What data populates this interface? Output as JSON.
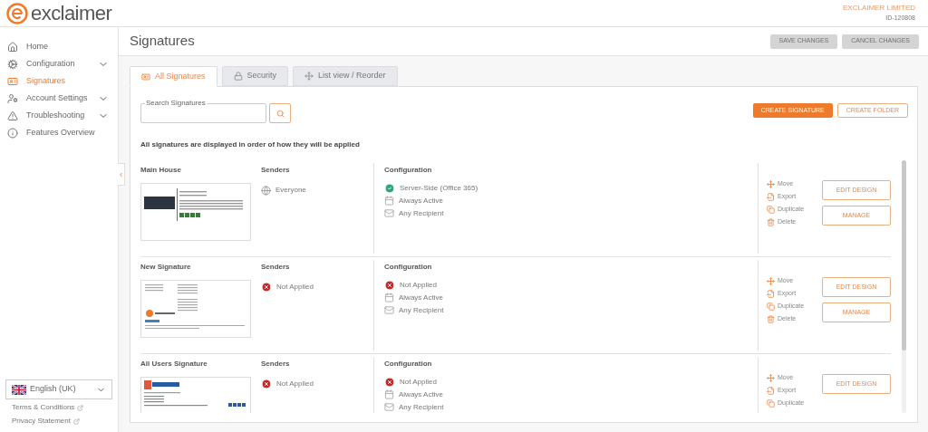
{
  "header": {
    "logo_text": "exclaimer",
    "account_name": "EXCLAIMER LIMITED",
    "account_id": "ID-120808"
  },
  "sidebar": {
    "items": [
      {
        "label": "Home",
        "selected": false,
        "expandable": false
      },
      {
        "label": "Configuration",
        "selected": false,
        "expandable": true
      },
      {
        "label": "Signatures",
        "selected": true,
        "expandable": false
      },
      {
        "label": "Account Settings",
        "selected": false,
        "expandable": true
      },
      {
        "label": "Troubleshooting",
        "selected": false,
        "expandable": true
      },
      {
        "label": "Features Overview",
        "selected": false,
        "expandable": false
      }
    ],
    "language": "English (UK)",
    "links": [
      "Terms & Conditions",
      "Privacy Statement"
    ]
  },
  "page": {
    "title": "Signatures",
    "buttons": [
      {
        "label": "SAVE CHANGES",
        "disabled": true
      },
      {
        "label": "CANCEL CHANGES",
        "disabled": true
      }
    ]
  },
  "tabs": [
    {
      "label": "All Signatures",
      "selected": true
    },
    {
      "label": "Security",
      "selected": false
    },
    {
      "label": "List view / Reorder",
      "selected": false
    }
  ],
  "search": {
    "label": "Search Signatures"
  },
  "actions": [
    {
      "label": "CREATE SIGNATURE",
      "kind": "primary"
    },
    {
      "label": "CREATE FOLDER",
      "kind": "outline"
    }
  ],
  "notice": "All signatures are displayed in order of how they will be applied",
  "signatures": [
    {
      "name": "Main House",
      "senders_heading": "Senders",
      "senders": {
        "text": "Everyone",
        "applied": true
      },
      "configuration_heading": "Configuration",
      "configuration": [
        {
          "text": "Server-Side (Office 365)",
          "kind": "status",
          "ok": true
        },
        {
          "text": "Always Active",
          "kind": "schedule"
        },
        {
          "text": "Any Recipient",
          "kind": "recipients"
        }
      ],
      "links": [
        "Move",
        "Export",
        "Duplicate",
        "Delete"
      ],
      "buttons": [
        "EDIT DESIGN",
        "MANAGE"
      ]
    },
    {
      "name": "New Signature",
      "senders_heading": "Senders",
      "senders": {
        "text": "Not Applied",
        "applied": false
      },
      "configuration_heading": "Configuration",
      "configuration": [
        {
          "text": "Not Applied",
          "kind": "status",
          "ok": false
        },
        {
          "text": "Always Active",
          "kind": "schedule"
        },
        {
          "text": "Any Recipient",
          "kind": "recipients"
        }
      ],
      "links": [
        "Move",
        "Export",
        "Duplicate",
        "Delete"
      ],
      "buttons": [
        "EDIT DESIGN",
        "MANAGE"
      ]
    },
    {
      "name": "All Users Signature",
      "senders_heading": "Senders",
      "senders": {
        "text": "Not Applied",
        "applied": false
      },
      "configuration_heading": "Configuration",
      "configuration": [
        {
          "text": "Not Applied",
          "kind": "status",
          "ok": false
        },
        {
          "text": "Always Active",
          "kind": "schedule"
        },
        {
          "text": "Any Recipient",
          "kind": "recipients"
        }
      ],
      "links": [
        "Move",
        "Export",
        "Duplicate"
      ],
      "buttons": [
        "EDIT DESIGN"
      ]
    }
  ]
}
